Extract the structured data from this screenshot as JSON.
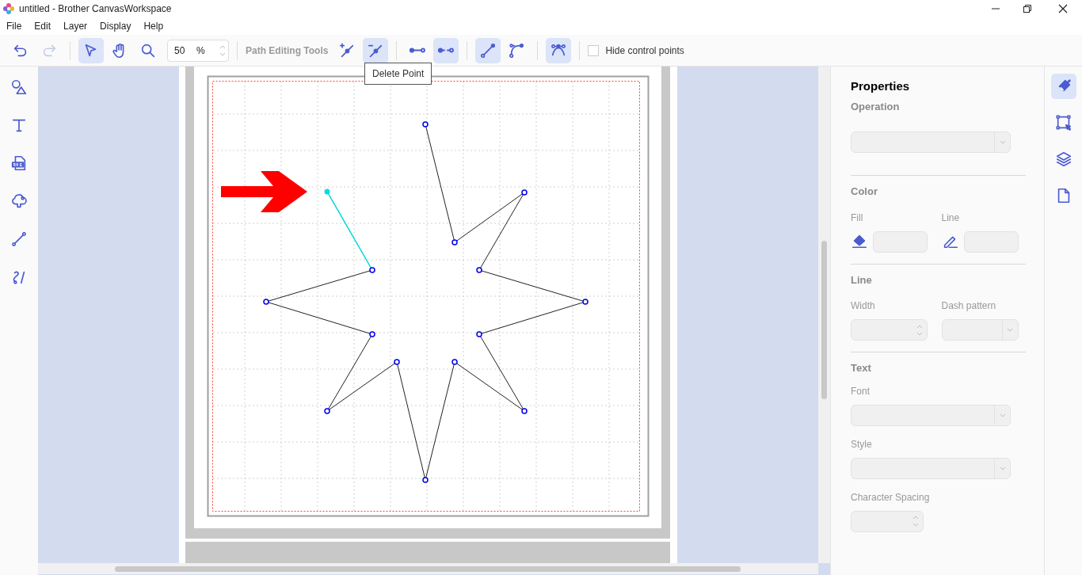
{
  "window": {
    "title": "untitled - Brother CanvasWorkspace"
  },
  "menu": [
    "File",
    "Edit",
    "Layer",
    "Display",
    "Help"
  ],
  "toolbar": {
    "history": [
      {
        "kind": "undo",
        "disabled": false
      },
      {
        "kind": "redo",
        "disabled": true
      }
    ],
    "modes": [
      {
        "kind": "select",
        "selected": true
      },
      {
        "kind": "hand",
        "selected": false
      },
      {
        "kind": "zoom",
        "selected": false
      }
    ],
    "zoom": {
      "value": "50",
      "unit": "%"
    },
    "path_tools_label": "Path Editing Tools",
    "path_groups": [
      [
        {
          "kind": "add-point",
          "selected": false
        },
        {
          "kind": "delete-point",
          "selected": true
        }
      ],
      [
        {
          "kind": "join-node",
          "selected": false
        },
        {
          "kind": "split-node",
          "selected": true
        }
      ],
      [
        {
          "kind": "straight",
          "selected": true
        },
        {
          "kind": "curve",
          "selected": false
        }
      ],
      [
        {
          "kind": "smooth",
          "selected": true
        }
      ]
    ],
    "hide_control_points": {
      "label": "Hide control points",
      "checked": false
    }
  },
  "tooltip": "Delete Point",
  "left_tools": [
    {
      "kind": "shapes"
    },
    {
      "kind": "text"
    },
    {
      "kind": "svg"
    },
    {
      "kind": "pattern"
    },
    {
      "kind": "line"
    },
    {
      "kind": "freehand"
    }
  ],
  "properties": {
    "title": "Properties",
    "sections": [
      {
        "heading": "Operation",
        "fields": [
          {
            "kind": "select"
          }
        ]
      },
      {
        "heading": "Color",
        "fields": [
          {
            "kind": "fill-color",
            "label": "Fill"
          },
          {
            "kind": "line-color",
            "label": "Line"
          }
        ]
      },
      {
        "heading": "Line",
        "fields": [
          {
            "kind": "spin",
            "label": "Width"
          },
          {
            "kind": "select",
            "label": "Dash pattern"
          }
        ]
      },
      {
        "heading": "Text",
        "fields": [
          {
            "kind": "select",
            "label": "Font"
          },
          {
            "kind": "select",
            "label": "Style"
          },
          {
            "kind": "spin-small",
            "label": "Character Spacing"
          }
        ]
      }
    ]
  },
  "right_tabs": [
    {
      "kind": "brush",
      "selected": true
    },
    {
      "kind": "transform",
      "selected": false
    },
    {
      "kind": "layers",
      "selected": false
    },
    {
      "kind": "page",
      "selected": false
    }
  ]
}
